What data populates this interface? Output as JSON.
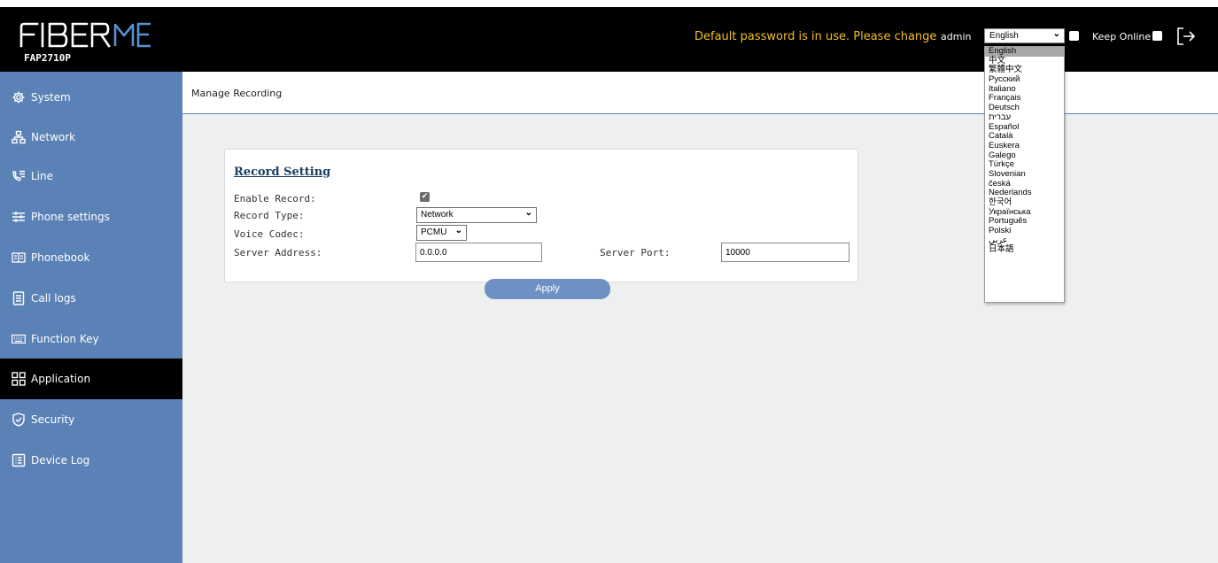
{
  "header": {
    "model": "FAP2710P",
    "logo_text": "FIBERME",
    "password_warning": "Default password is in use. Please change",
    "user": "admin",
    "language_selected": "English",
    "keep_online_label": "Keep Online"
  },
  "sidebar": {
    "items": [
      {
        "label": "System",
        "icon": "gear-icon"
      },
      {
        "label": "Network",
        "icon": "network-icon"
      },
      {
        "label": "Line",
        "icon": "phone-lines-icon"
      },
      {
        "label": "Phone settings",
        "icon": "sliders-icon"
      },
      {
        "label": "Phonebook",
        "icon": "book-icon"
      },
      {
        "label": "Call logs",
        "icon": "list-doc-icon"
      },
      {
        "label": "Function Key",
        "icon": "keyboard-icon"
      },
      {
        "label": "Application",
        "icon": "grid-icon",
        "active": true
      },
      {
        "label": "Security",
        "icon": "shield-icon"
      },
      {
        "label": "Device Log",
        "icon": "log-icon"
      }
    ]
  },
  "tabs": [
    {
      "label": "Manage Recording"
    }
  ],
  "record_setting": {
    "title": "Record Setting",
    "enable_record_label": "Enable Record:",
    "enable_record_checked": true,
    "record_type_label": "Record Type:",
    "record_type_value": "Network",
    "voice_codec_label": "Voice Codec:",
    "voice_codec_value": "PCMU",
    "server_address_label": "Server Address:",
    "server_address_value": "0.0.0.0",
    "server_port_label": "Server Port:",
    "server_port_value": "10000",
    "apply_label": "Apply"
  },
  "language_options": [
    "English",
    "中文",
    "繁體中文",
    "Русский",
    "Italiano",
    "Français",
    "Deutsch",
    "עברית",
    "Español",
    "Català",
    "Euskera",
    "Galego",
    "Türkçe",
    "Slovenian",
    "česká",
    "Nederlands",
    "한국어",
    "Українська",
    "Português",
    "Polski",
    "عربي",
    "日本語"
  ],
  "colors": {
    "sidebar_bg": "#5b82b6",
    "active_nav_bg": "#000000",
    "warning_text": "#f3c01f",
    "apply_button": "#6f90c2"
  }
}
